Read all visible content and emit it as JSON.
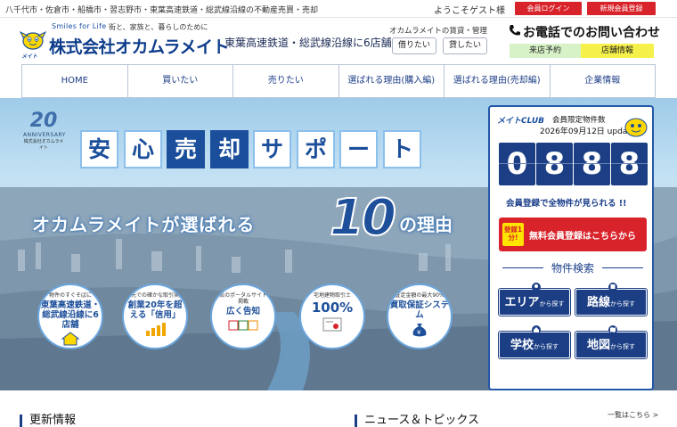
{
  "topbar": {
    "tagline": "八千代市・佐倉市・船橋市・習志野市・東葉高速鉄道・総武線沿線の不動産売買・売却",
    "welcome": "ようこそゲスト様",
    "login_label": "会員ログイン",
    "register_label": "新規会員登録",
    "accent": "#d8232a"
  },
  "header": {
    "logo_tagline": "Smiles for Life",
    "logo_tagline2": "街と、家族と、暮らしのために",
    "logo_name": "株式会社オカムラメイト",
    "logo_mark_text": "メイト",
    "tagline": "東葉高速鉄道・総武線沿線に6店舗",
    "rent_title": "オカムラメイトの賃貸・管理",
    "rent_borrow": "借りたい",
    "rent_lend": "貸したい",
    "phone_text": "お電話でのお問い合わせ",
    "store_visit": "来店予約",
    "store_info": "店舗情報"
  },
  "nav": {
    "items": [
      "HOME",
      "買いたい",
      "売りたい",
      "選ばれる理由(購入編)",
      "選ばれる理由(売却編)",
      "企業情報"
    ]
  },
  "hero": {
    "anniversary_number": "20",
    "anniversary_text": "ANNIVERSARY",
    "anniversary_company": "株式会社オカムラメイト",
    "headline_chars": [
      "安",
      "心",
      "売",
      "却",
      "サ",
      "ポ",
      "ー",
      "ト"
    ],
    "reason_prefix": "オカムラメイトが選ばれる",
    "reason_number": "10",
    "reason_suffix": "の理由",
    "features": [
      {
        "small": "物件のすぐそばに",
        "big": "東葉高速鉄道・総武線沿線に6店舗",
        "icon": "house-icon"
      },
      {
        "small": "地元での確かな取引実績",
        "big": "創業20年を超える「信用」",
        "icon": "growth-chart-icon"
      },
      {
        "small": "人気のポータルサイトへ掲載",
        "big": "広く告知",
        "icon": "portal-sites-icon"
      },
      {
        "small": "宅地建物取引士",
        "big": "100%",
        "icon": "certificate-icon"
      },
      {
        "small": "査定金額の最大90%",
        "big": "買取保証システム",
        "icon": "money-bag-icon"
      }
    ]
  },
  "panel": {
    "club_logo": "メイトCLUB",
    "title": "会員限定物件数",
    "date": "2026年09月12日 update",
    "digits": [
      "0",
      "8",
      "8",
      "8"
    ],
    "members_text": "会員登録で全物件が見られる !!",
    "register_badge": "登録1分!",
    "register_text": "無料会員登録はこちらから",
    "search_title": "物件検索",
    "search_buttons": [
      {
        "main": "エリア",
        "sub": "から探す"
      },
      {
        "main": "路線",
        "sub": "から探す"
      },
      {
        "main": "学校",
        "sub": "から探す"
      },
      {
        "main": "地図",
        "sub": "から探す"
      }
    ],
    "navy": "#1b3e84"
  },
  "bottom": {
    "updates": "更新情報",
    "news": "ニュース＆トピックス",
    "more": "一覧はこちら >"
  }
}
